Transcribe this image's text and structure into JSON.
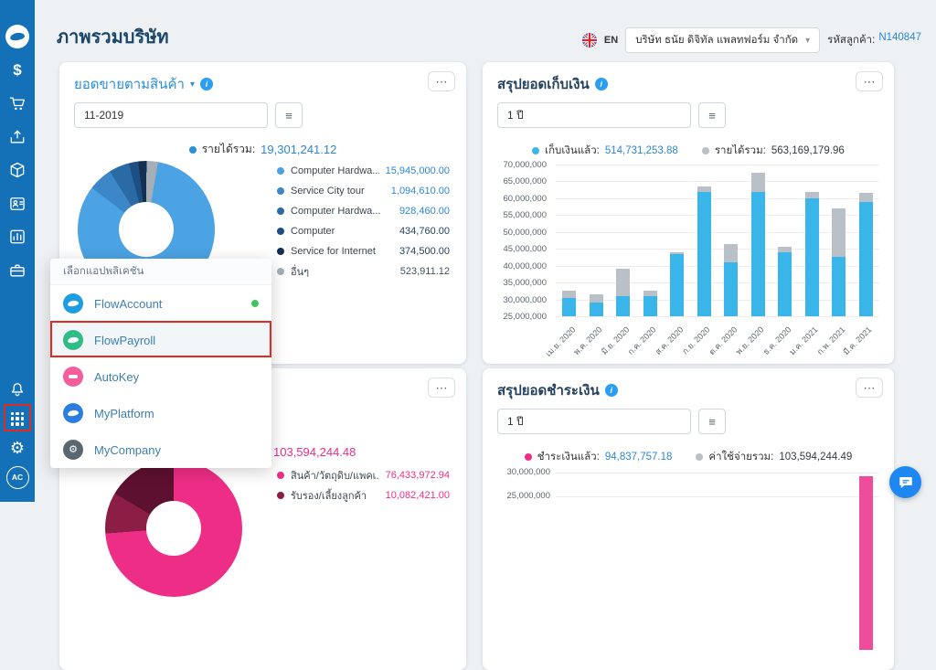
{
  "colors": {
    "sidebar_blue": "#1471b8",
    "accent_blue": "#2a8fd8",
    "link_blue": "#2e86d1",
    "pink": "#ee2d87",
    "annotation_red": "#e02b20",
    "bar_blue": "#3ab5e9",
    "bar_gray": "#b9c0c7",
    "online_green": "#43c463"
  },
  "common": {
    "menu_button_icon": "⋯",
    "filter_button_icon": "≡",
    "chevron": "▾",
    "info_icon": "i"
  },
  "header": {
    "title": "ภาพรวมบริษัท",
    "language": "EN",
    "company_name": "บริษัท ธนัย ดิจิทัล แพลทฟอร์ม จำกัด",
    "customer_code_label": "รหัสลูกค้า:",
    "customer_code_value": "N140847"
  },
  "sidebar": {
    "icons": [
      "flowaccount-logo",
      "money",
      "cart",
      "tray",
      "package",
      "contacts",
      "reports",
      "briefcase",
      "bell",
      "apps-grid",
      "gear",
      "account-avatar"
    ],
    "avatar_text": "AC"
  },
  "cards": {
    "sales": {
      "title": "ยอดขายตามสินค้า",
      "filter_value": "11-2019",
      "total_label": "รายได้รวม:",
      "total_value": "19,301,241.12",
      "legend": [
        {
          "label": "Computer Hardwa...",
          "value": "15,945,000.00",
          "color": "#4ba3e3",
          "value_color": "#2e86d1"
        },
        {
          "label": "Service City tour",
          "value": "1,094,610.00",
          "color": "#3c87c8",
          "value_color": "#2e86d1"
        },
        {
          "label": "Computer Hardwa...",
          "value": "928,460.00",
          "color": "#2a6aa5",
          "value_color": "#2e86d1"
        },
        {
          "label": "Computer",
          "value": "434,760.00",
          "color": "#1d4f82",
          "value_color": "#24425e"
        },
        {
          "label": "Service for Internet",
          "value": "374,500.00",
          "color": "#142f52",
          "value_color": "#24425e"
        },
        {
          "label": "อื่นๆ",
          "value": "523,911.12",
          "color": "#a6aeb6",
          "value_color": "#44505c"
        }
      ]
    },
    "collection": {
      "title": "สรุปยอดเก็บเงิน",
      "filter_value": "1 ปี",
      "legend": [
        {
          "label": "เก็บเงินแล้ว:",
          "value": "514,731,253.88",
          "color": "#3ab5e9",
          "value_color": "#2e86d1"
        },
        {
          "label": "รายได้รวม:",
          "value": "563,169,179.96",
          "color": "#b9c0c7",
          "value_color": "#333b44"
        }
      ]
    },
    "expenses": {
      "total_value": "103,594,244.48",
      "legend": [
        {
          "label": "สินค้า/วัตถุดิบ/แพคเ...",
          "value": "76,433,972.94",
          "color": "#ee2d87",
          "value_color": "#ee2d87"
        },
        {
          "label": "รับรอง/เลี้ยงลูกค้า",
          "value": "10,082,421.00",
          "color": "#8c1d45",
          "value_color": "#ee2d87"
        }
      ]
    },
    "payments": {
      "title": "สรุปยอดชำระเงิน",
      "filter_value": "1 ปี",
      "legend": [
        {
          "label": "ชำระเงินแล้ว:",
          "value": "94,837,757.18",
          "color": "#ee2d87",
          "value_color": "#2e86d1"
        },
        {
          "label": "ค่าใช้จ่ายรวม:",
          "value": "103,594,244.49",
          "color": "#b9c0c7",
          "value_color": "#333b44"
        }
      ],
      "y_ticks": [
        "30,000,000",
        "25,000,000"
      ]
    }
  },
  "app_menu": {
    "title": "เลือกแอปพลิเคชัน",
    "items": [
      {
        "label": "FlowAccount",
        "color": "#1e9de3",
        "online": true
      },
      {
        "label": "FlowPayroll",
        "color": "#2ebd85",
        "highlighted": true
      },
      {
        "label": "AutoKey",
        "color": "#f45c9a"
      },
      {
        "label": "MyPlatform",
        "color": "#2a7de1"
      },
      {
        "label": "MyCompany",
        "color": "#5b6770"
      }
    ]
  },
  "chart_data": [
    {
      "name": "sales_by_product",
      "type": "donut",
      "title": "ยอดขายตามสินค้า",
      "period": "11-2019",
      "total": 19301241.12,
      "segments": [
        {
          "label": "Computer Hardwa...",
          "value": 15945000.0,
          "color": "#4ba3e3"
        },
        {
          "label": "Service City tour",
          "value": 1094610.0,
          "color": "#3c87c8"
        },
        {
          "label": "Computer Hardwa...",
          "value": 928460.0,
          "color": "#2a6aa5"
        },
        {
          "label": "Computer",
          "value": 434760.0,
          "color": "#1d4f82"
        },
        {
          "label": "Service for Internet",
          "value": 374500.0,
          "color": "#142f52"
        },
        {
          "label": "อื่นๆ",
          "value": 523911.12,
          "color": "#a6aeb6"
        }
      ]
    },
    {
      "name": "collection_summary",
      "type": "bar",
      "title": "สรุปยอดเก็บเงิน",
      "period": "1 ปี",
      "categories": [
        "เม.ย. 2020",
        "พ.ค. 2020",
        "มิ.ย. 2020",
        "ก.ค. 2020",
        "ส.ค. 2020",
        "ก.ย. 2020",
        "ต.ค. 2020",
        "พ.ย. 2020",
        "ธ.ค. 2020",
        "ม.ค. 2021",
        "ก.พ. 2021",
        "มี.ค. 2021"
      ],
      "series": [
        {
          "name": "เก็บเงินแล้ว",
          "total": 514731253.88,
          "color": "#3ab5e9",
          "values": [
            30500000,
            29000000,
            31000000,
            31000000,
            43500000,
            62000000,
            41000000,
            62000000,
            44000000,
            60000000,
            42500000,
            59000000
          ]
        },
        {
          "name": "รายได้รวม",
          "total": 563169179.96,
          "color": "#b9c0c7",
          "values": [
            32500000,
            31500000,
            39000000,
            32500000,
            44000000,
            63500000,
            46500000,
            67500000,
            45500000,
            62000000,
            57000000,
            61500000
          ]
        }
      ],
      "ylim": [
        25000000,
        70000000
      ],
      "ytick_step": 5000000,
      "values_note": "monthly values estimated from bar heights"
    },
    {
      "name": "expenses_by_product",
      "type": "donut",
      "total": 103594244.48,
      "segments": [
        {
          "label": "สินค้า/วัตถุดิบ/แพคเ...",
          "value": 76433972.94,
          "color": "#ee2d87"
        },
        {
          "label": "รับรอง/เลี้ยงลูกค้า",
          "value": 10082421.0,
          "color": "#8c1d45"
        },
        {
          "label": "others (hidden behind popup)",
          "value": 17077850.54,
          "color": "#5e1030"
        }
      ],
      "values_note": "card partially hidden behind app menu popup"
    },
    {
      "name": "payment_summary",
      "type": "bar",
      "title": "สรุปยอดชำระเงิน",
      "period": "1 ปี",
      "series": [
        {
          "name": "ชำระเงินแล้ว",
          "total": 94837757.18,
          "color": "#ee2d87"
        },
        {
          "name": "ค่าใช้จ่ายรวม",
          "total": 103594244.49,
          "color": "#b9c0c7"
        }
      ],
      "visible_y_ticks": [
        30000000,
        25000000
      ],
      "values_note": "chart mostly clipped below viewport edge; one pink bar visible at right"
    }
  ]
}
